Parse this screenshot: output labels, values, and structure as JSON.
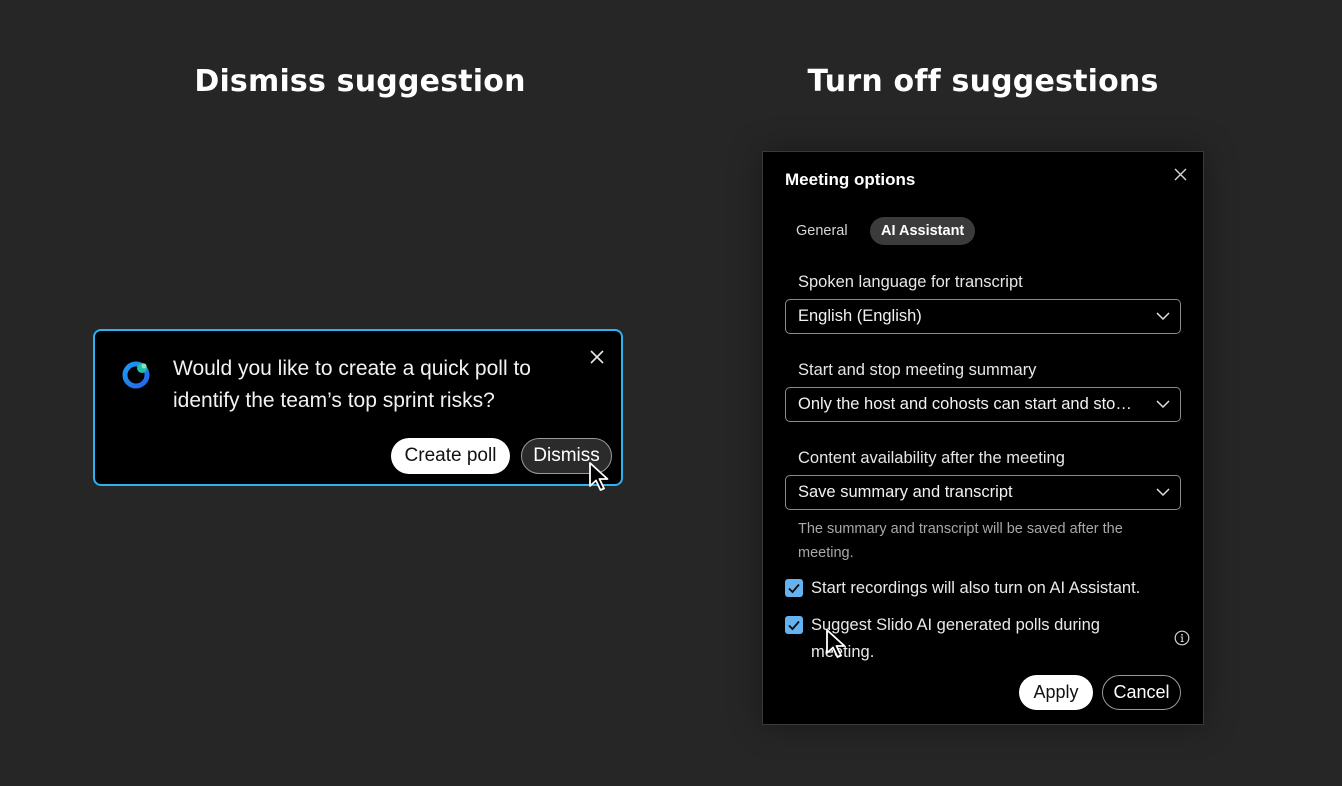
{
  "headings": {
    "left": "Dismiss suggestion",
    "right": "Turn off suggestions"
  },
  "toast": {
    "message": "Would you like to create a quick poll to identify the team’s top sprint risks?",
    "primary_button": "Create poll",
    "secondary_button": "Dismiss",
    "logo_icon": "slido-ai-icon",
    "close_icon": "close-icon",
    "border_color": "#2fb0f0"
  },
  "dialog": {
    "title": "Meeting options",
    "tabs": [
      {
        "label": "General",
        "selected": false
      },
      {
        "label": "AI Assistant",
        "selected": true
      }
    ],
    "fields": [
      {
        "label": "Spoken language for transcript",
        "value": "English (English)"
      },
      {
        "label": "Start and stop meeting summary",
        "value": "Only the host and cohosts can start and stop meeting summary"
      },
      {
        "label": "Content availability after the meeting",
        "value": "Save summary and transcript"
      }
    ],
    "help_text": "The summary and transcript will be saved after the meeting.",
    "checkboxes": [
      {
        "label": "Start recordings will also turn on AI Assistant.",
        "checked": true
      },
      {
        "label": "Suggest Slido AI generated polls during meeting.",
        "checked": true
      }
    ],
    "apply_label": "Apply",
    "cancel_label": "Cancel",
    "checkbox_color": "#64b2f0"
  }
}
